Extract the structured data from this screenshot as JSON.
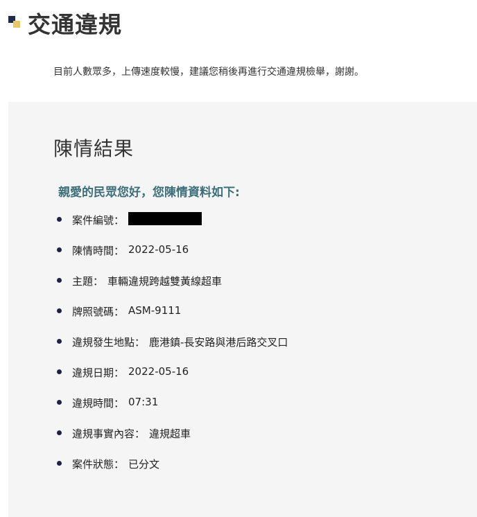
{
  "header": {
    "title": "交通違規",
    "logo_colors": {
      "dark": "#1f2a4a",
      "gold": "#e8c66a"
    }
  },
  "notice": "目前人數眾多，上傳速度較慢，建議您稍後再進行交通違規檢舉，謝謝。",
  "result": {
    "title": "陳情結果",
    "greeting": "親愛的民眾您好，您陳情資料如下:",
    "items": [
      {
        "label": "案件編號：",
        "value": "",
        "redacted": true
      },
      {
        "label": "陳情時間：",
        "value": "2022-05-16"
      },
      {
        "label": "主題：",
        "value": "車輛違規跨越雙黃線超車"
      },
      {
        "label": "牌照號碼：",
        "value": "ASM-9111"
      },
      {
        "label": "違規發生地點：",
        "value": "鹿港鎮-長安路與港后路交叉口"
      },
      {
        "label": "違規日期：",
        "value": "2022-05-16"
      },
      {
        "label": "違規時間：",
        "value": "07:31"
      },
      {
        "label": "違規事實內容：",
        "value": "違規超車"
      },
      {
        "label": "案件狀態：",
        "value": "已分文"
      }
    ]
  },
  "colors": {
    "panel_bg": "#f5f5f6",
    "greeting": "#3d6e7a",
    "bullet": "#1e2345"
  }
}
